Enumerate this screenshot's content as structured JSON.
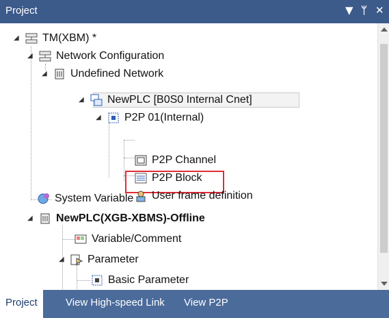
{
  "panel": {
    "title": "Project",
    "controls": {
      "dropdown": "▼",
      "pin": "ᛘ",
      "close": "✕"
    }
  },
  "tree": [
    {
      "label": "TM(XBM) *",
      "icon": "network-config-icon",
      "expander": "◢"
    },
    {
      "label": "Network Configuration",
      "icon": "network-config-icon",
      "expander": "◢"
    },
    {
      "label": "Undefined Network",
      "icon": "network-icon",
      "expander": "◢"
    },
    {
      "label": "NewPLC [B0S0 Internal Cnet]",
      "icon": "plc-icon",
      "expander": "◢"
    },
    {
      "label": "P2P 01(Internal)",
      "icon": "p2p-icon",
      "expander": "◢"
    },
    {
      "label": "P2P Channel",
      "icon": "channel-icon"
    },
    {
      "label": "P2P Block",
      "icon": "block-icon"
    },
    {
      "label": "User frame definition",
      "icon": "user-frame-icon"
    },
    {
      "label": "System Variable",
      "icon": "system-variable-icon"
    },
    {
      "label": "NewPLC(XGB-XBMS)-Offline",
      "icon": "network-icon",
      "expander": "◢"
    },
    {
      "label": "Variable/Comment",
      "icon": "variable-comment-icon"
    },
    {
      "label": "Parameter",
      "icon": "parameter-icon",
      "expander": "◢"
    },
    {
      "label": "Basic Parameter",
      "icon": "basic-parameter-icon"
    }
  ],
  "tabs": [
    {
      "label": "Project",
      "active": true
    },
    {
      "label": "View High-speed Link"
    },
    {
      "label": "View P2P"
    }
  ],
  "colors": {
    "titlebar": "#3c5a8a",
    "tabbar": "#4b6b9b",
    "highlight": "#e22b36"
  }
}
